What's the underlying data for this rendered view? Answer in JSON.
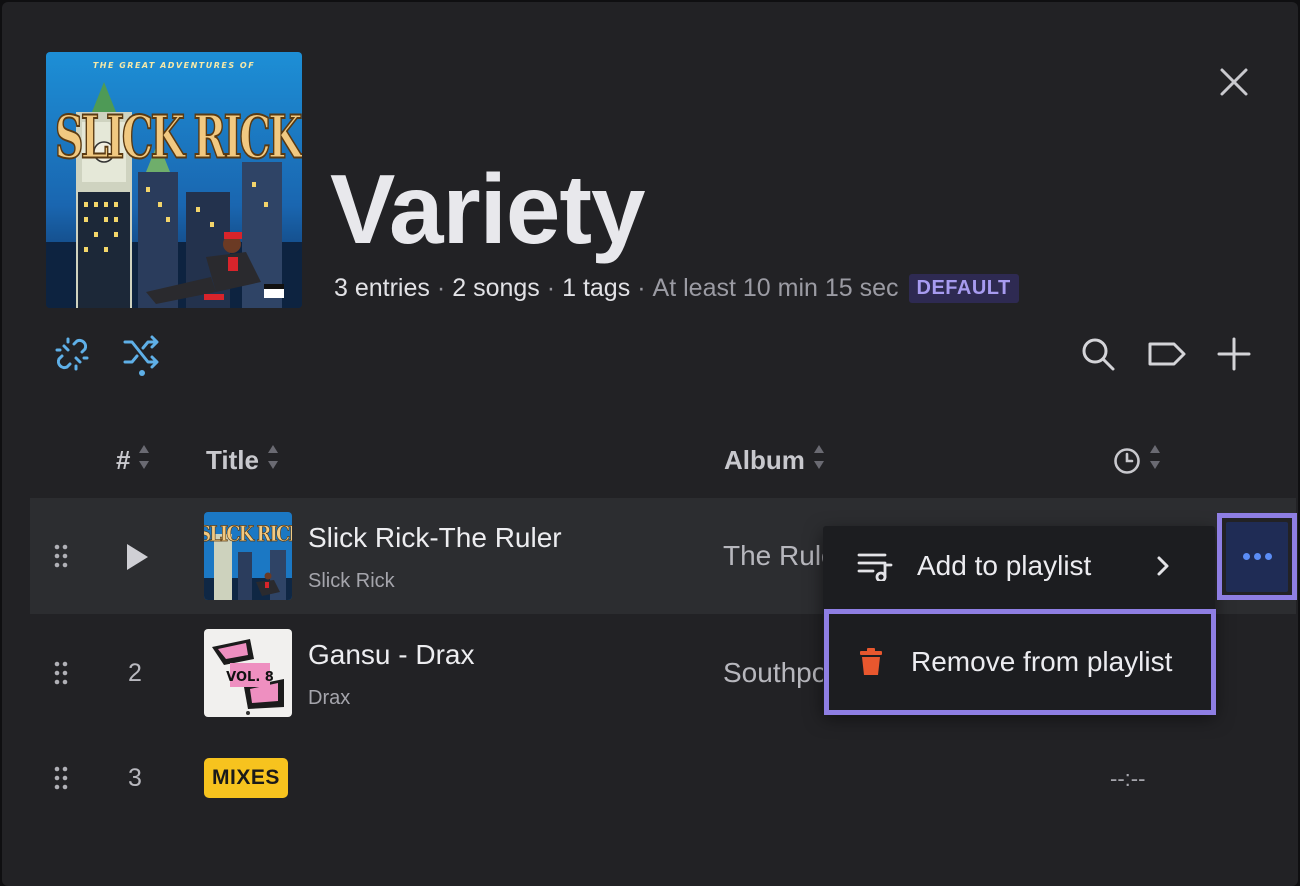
{
  "playlist": {
    "title": "Variety",
    "entries": "3 entries",
    "songs": "2 songs",
    "tags": "1 tags",
    "duration": "At least 10 min 15 sec",
    "badge": "DEFAULT",
    "cover_text_top": "THE GREAT ADVENTURES OF",
    "cover_text_main": "SLICK RICK"
  },
  "columns": {
    "number": "#",
    "title": "Title",
    "album": "Album"
  },
  "tracks": [
    {
      "number": "",
      "title": "Slick Rick-The Ruler",
      "artist": "Slick Rick",
      "album": "The Rule",
      "duration": ""
    },
    {
      "number": "2",
      "title": "Gansu - Drax",
      "artist": "Drax",
      "album": "Southpo",
      "duration": "",
      "thumb_text": "VOL. 8"
    },
    {
      "number": "3",
      "title": "",
      "artist": "",
      "album": "",
      "duration": "--:--",
      "tag": "MIXES"
    }
  ],
  "menu": {
    "add_to_playlist": "Add to playlist",
    "remove_from_playlist": "Remove from playlist"
  },
  "colors": {
    "accent_link": "#5fb0e8",
    "highlight_border": "#8e7ee3",
    "trash": "#e8572e",
    "mixes_tag": "#f7c31e"
  }
}
